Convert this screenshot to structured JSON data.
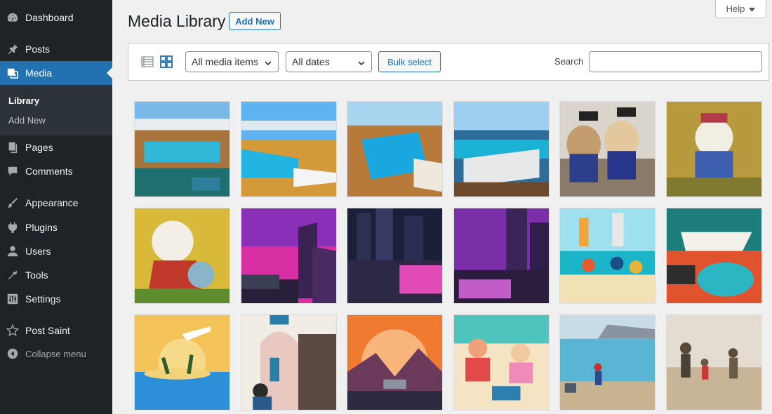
{
  "sidebar": {
    "items": [
      {
        "label": "Dashboard",
        "icon": "dashboard-icon"
      },
      {
        "label": "Posts",
        "icon": "pin-icon"
      },
      {
        "label": "Media",
        "icon": "media-icon"
      },
      {
        "label": "Pages",
        "icon": "pages-icon"
      },
      {
        "label": "Comments",
        "icon": "comment-icon"
      },
      {
        "label": "Appearance",
        "icon": "brush-icon"
      },
      {
        "label": "Plugins",
        "icon": "plug-icon"
      },
      {
        "label": "Users",
        "icon": "user-icon"
      },
      {
        "label": "Tools",
        "icon": "wrench-icon"
      },
      {
        "label": "Settings",
        "icon": "sliders-icon"
      },
      {
        "label": "Post Saint",
        "icon": "star-icon"
      }
    ],
    "submenu": [
      {
        "label": "Library"
      },
      {
        "label": "Add New"
      }
    ],
    "collapse_label": "Collapse menu",
    "accent_color": "#2271b1"
  },
  "help": {
    "label": "Help"
  },
  "header": {
    "title": "Media Library",
    "add_new_label": "Add New"
  },
  "toolbar": {
    "filter_type": "All media items",
    "filter_date": "All dates",
    "bulk_label": "Bulk select",
    "search_label": "Search",
    "search_value": ""
  },
  "media": [
    {
      "subject": "cruise-pool"
    },
    {
      "subject": "cruise-deck"
    },
    {
      "subject": "cruise-pool"
    },
    {
      "subject": "cruise-pool"
    },
    {
      "subject": "dogs"
    },
    {
      "subject": "dog"
    },
    {
      "subject": "dog"
    },
    {
      "subject": "synthwave-city"
    },
    {
      "subject": "night-city-car"
    },
    {
      "subject": "synthwave-city"
    },
    {
      "subject": "beach-party"
    },
    {
      "subject": "cruise-ship"
    },
    {
      "subject": "airplane-island"
    },
    {
      "subject": "greek-couple"
    },
    {
      "subject": "desert-car"
    },
    {
      "subject": "beach-family"
    },
    {
      "subject": "beach-painting"
    },
    {
      "subject": "beach-watercolor"
    }
  ]
}
